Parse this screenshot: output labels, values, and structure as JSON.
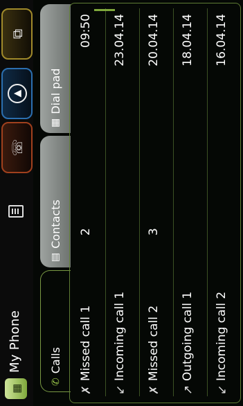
{
  "header": {
    "title": "My Phone",
    "phone_icon": "phone-keypad-icon"
  },
  "status": {
    "battery_icon": "battery-icon"
  },
  "shortcuts": [
    {
      "name": "media",
      "icon": "media-phone-icon",
      "glyph": "☏",
      "color": "#a0401d"
    },
    {
      "name": "navigation",
      "icon": "navigation-icon",
      "glyph": "▲",
      "color": "#2b6fb0"
    },
    {
      "name": "connectivity",
      "icon": "devices-icon",
      "glyph": "⧉",
      "color": "#a08a2a"
    }
  ],
  "tabs": [
    {
      "label": "Calls",
      "icon": "phone-icon",
      "active": true
    },
    {
      "label": "Contacts",
      "icon": "contacts-icon",
      "active": false
    },
    {
      "label": "Dial pad",
      "icon": "dialpad-icon",
      "active": false
    }
  ],
  "calls": [
    {
      "type": "missed",
      "icon": "missed-call-icon",
      "name": "Missed call 1",
      "count": "2",
      "date": "09:50"
    },
    {
      "type": "incoming",
      "icon": "incoming-call-icon",
      "name": "Incoming call 1",
      "count": "",
      "date": "23.04.14"
    },
    {
      "type": "missed",
      "icon": "missed-call-icon",
      "name": "Missed call 2",
      "count": "3",
      "date": "20.04.14"
    },
    {
      "type": "outgoing",
      "icon": "outgoing-call-icon",
      "name": "Outgoing call 1",
      "count": "",
      "date": "18.04.14"
    },
    {
      "type": "incoming",
      "icon": "incoming-call-icon",
      "name": "Incoming call 2",
      "count": "",
      "date": "16.04.14"
    }
  ]
}
